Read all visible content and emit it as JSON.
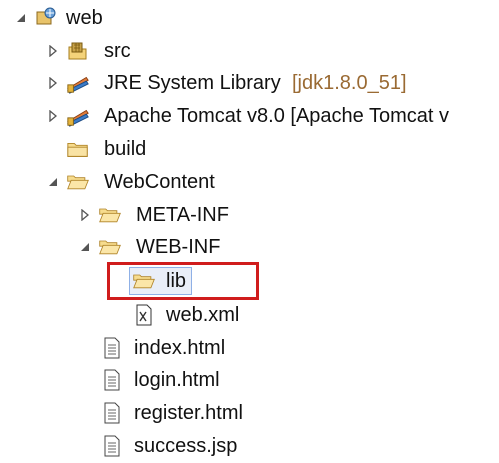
{
  "tree": {
    "root": {
      "label": "web",
      "expanded": true
    },
    "items": [
      {
        "label": "src",
        "icon": "source-folder-icon",
        "expanded": false
      },
      {
        "label": "JRE System Library",
        "decoration": "[jdk1.8.0_51]",
        "icon": "library-icon",
        "expanded": false
      },
      {
        "label": "Apache Tomcat v8.0 [Apache Tomcat v",
        "icon": "library-icon",
        "expanded": false
      },
      {
        "label": "build",
        "icon": "folder-icon"
      },
      {
        "label": "WebContent",
        "icon": "open-folder-icon",
        "expanded": true
      },
      {
        "label": "META-INF",
        "icon": "folder-icon",
        "expanded": false
      },
      {
        "label": "WEB-INF",
        "icon": "open-folder-icon",
        "expanded": true
      },
      {
        "label": "lib",
        "icon": "open-folder-icon",
        "selected": true
      },
      {
        "label": "web.xml",
        "icon": "xml-file-icon"
      },
      {
        "label": "index.html",
        "icon": "file-icon"
      },
      {
        "label": "login.html",
        "icon": "file-icon"
      },
      {
        "label": "register.html",
        "icon": "file-icon"
      },
      {
        "label": "success.jsp",
        "icon": "file-icon"
      }
    ]
  },
  "colors": {
    "highlight_border": "#d01c1c",
    "decoration_text": "#9a6a33",
    "selection_background": "#e9eef8"
  }
}
